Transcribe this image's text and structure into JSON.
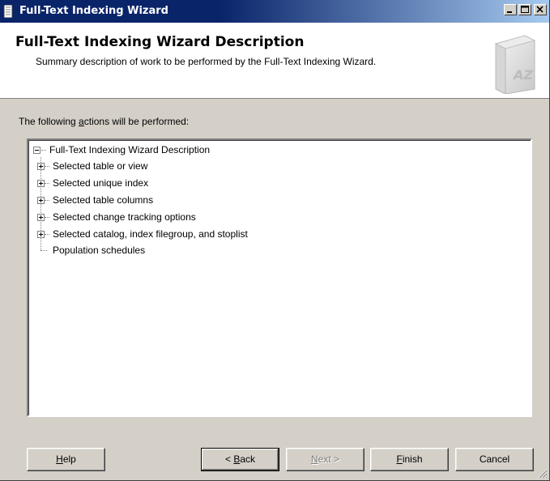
{
  "window": {
    "title": "Full-Text Indexing Wizard",
    "controls": [
      "minimize",
      "maximize",
      "close"
    ]
  },
  "header": {
    "title": "Full-Text Indexing Wizard Description",
    "subtitle": "Summary description of work to be performed by the Full-Text Indexing Wizard.",
    "graphic_text": "AZ",
    "graphic_icon": "book-az-icon"
  },
  "body": {
    "actions_label_pre": "The following ",
    "actions_label_accel": "a",
    "actions_label_post": "ctions will be performed:"
  },
  "tree": {
    "root": {
      "label": "Full-Text Indexing Wizard Description",
      "expanded": true
    },
    "children": [
      {
        "label": "Selected table or view",
        "expandable": true
      },
      {
        "label": "Selected unique index",
        "expandable": true
      },
      {
        "label": "Selected table columns",
        "expandable": true
      },
      {
        "label": "Selected change tracking options",
        "expandable": true
      },
      {
        "label": "Selected catalog, index filegroup, and stoplist",
        "expandable": true
      },
      {
        "label": "Population schedules",
        "expandable": false
      }
    ]
  },
  "buttons": {
    "help": {
      "accel": "H",
      "rest": "elp"
    },
    "back": {
      "pre": "< ",
      "accel": "B",
      "rest": "ack"
    },
    "next": {
      "accel": "N",
      "rest": "ext >",
      "disabled": true
    },
    "finish": {
      "accel": "F",
      "rest": "inish"
    },
    "cancel": {
      "label": "Cancel"
    }
  },
  "colors": {
    "titlebar_start": "#0a246a",
    "titlebar_end": "#a6caf0",
    "dialog_face": "#d4d0c8"
  }
}
